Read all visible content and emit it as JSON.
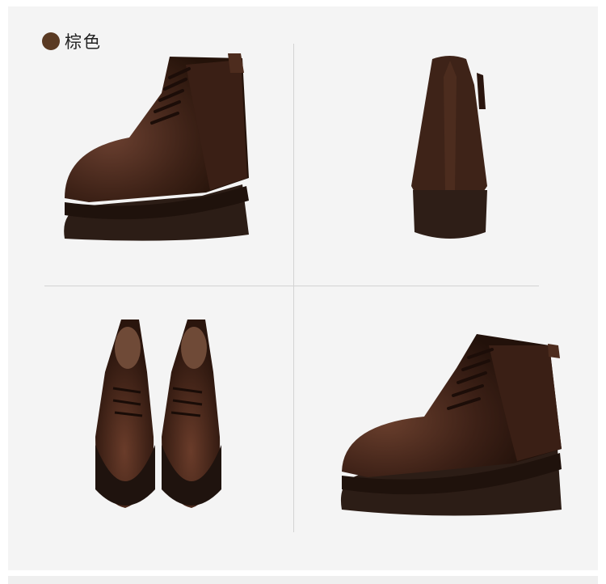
{
  "color_label": {
    "text": "棕色",
    "swatch_color": "#5a3a23"
  },
  "colors": {
    "leather": "#4a2a1d",
    "leather_dark": "#2d1812",
    "sole": "#2f2019",
    "panel_bg": "#f4f4f4",
    "divider": "#d3d3d3"
  }
}
